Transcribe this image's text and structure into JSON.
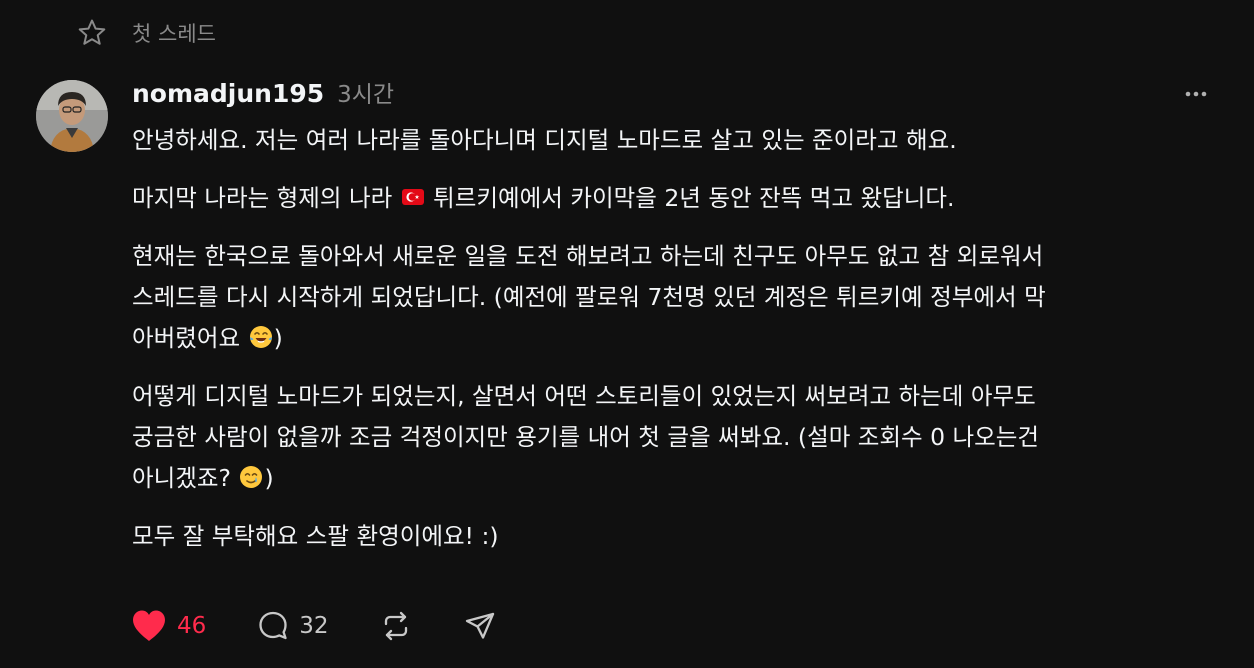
{
  "header": {
    "label": "첫 스레드",
    "icon": "star-icon"
  },
  "post": {
    "username": "nomadjun195",
    "time": "3시간",
    "paragraphs": {
      "p1": "안녕하세요. 저는 여러 나라를 돌아다니며 디지털 노마드로 살고 있는 준이라고 해요.",
      "p2_before": "마지막 나라는 형제의 나라 ",
      "p2_after": " 튀르키예에서 카이막을 2년 동안 잔뜩 먹고 왔답니다.",
      "p3_line1": "현재는 한국으로 돌아와서 새로운 일을 도전 해보려고 하는데 친구도 아무도 없고 참 외로워서",
      "p3_line2": "스레드를 다시 시작하게 되었답니다. (예전에 팔로워 7천명 있던 계정은 튀르키예 정부에서 막",
      "p3_line3": "아버렸어요 ",
      "p3_end": ")",
      "p4_line1": "어떻게 디지털 노마드가 되었는지, 살면서 어떤 스토리들이 있었는지 써보려고 하는데 아무도",
      "p4_line2": "궁금한 사람이 없을까 조금 걱정이지만 용기를 내어 첫 글을 써봐요. (설마 조회수 0 나오는건",
      "p4_line3": "아니겠죠? ",
      "p4_end": ")",
      "p5": "모두 잘 부탁해요 스팔 환영이에요! :)"
    },
    "emojis": {
      "flag": "turkey-flag-emoji",
      "laugh": "tears-of-joy-emoji",
      "tear": "smiling-face-with-tear-emoji"
    }
  },
  "actions": {
    "likes": "46",
    "comments": "32",
    "like_color": "#ff2b4c"
  },
  "colors": {
    "background": "#101010",
    "text": "#f3f5f7",
    "muted": "#8a8a8a"
  }
}
